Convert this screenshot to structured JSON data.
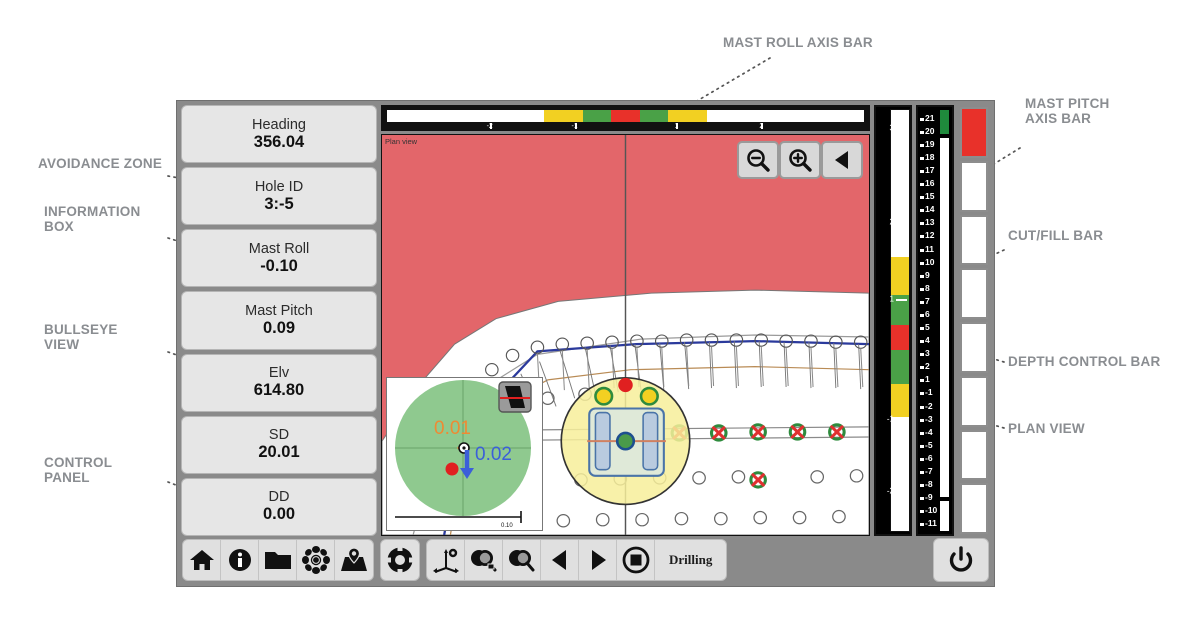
{
  "annotations": {
    "mast_roll_axis_bar": "MAST ROLL AXIS BAR",
    "avoidance_zone": "AVOIDANCE ZONE",
    "information_box": "INFORMATION\nBOX",
    "bullseye_view": "BULLSEYE\nVIEW",
    "control_panel": "CONTROL\nPANEL",
    "mast_pitch_axis_bar": "MAST PITCH\nAXIS BAR",
    "cut_fill_bar": "CUT/FILL BAR",
    "depth_control_bar": "DEPTH CONTROL BAR",
    "plan_view": "PLAN VIEW"
  },
  "info_panel": {
    "items": [
      {
        "label": "Heading",
        "value": "356.04"
      },
      {
        "label": "Hole ID",
        "value": "3:-5"
      },
      {
        "label": "Mast Roll",
        "value": "-0.10"
      },
      {
        "label": "Mast Pitch",
        "value": "0.09"
      },
      {
        "label": "Elv",
        "value": "614.80"
      },
      {
        "label": "SD",
        "value": "20.01"
      },
      {
        "label": "DD",
        "value": "0.00"
      }
    ]
  },
  "plan_view": {
    "label": "Plan view",
    "buttons": [
      {
        "name": "zoom-out-button",
        "icon": "magnifier-minus-icon"
      },
      {
        "name": "zoom-in-button",
        "icon": "magnifier-plus-icon"
      },
      {
        "name": "back-button",
        "icon": "triangle-left-icon"
      }
    ],
    "avoidance_zone_color": "#e3666a",
    "ground_color": "#ffffff",
    "design_line_color": "#2b3a9c",
    "rig_circle_color": "#f7ef9a"
  },
  "bullseye": {
    "offset_across": "0.01",
    "offset_along": "0.02",
    "across_color": "#ef8a33",
    "along_color": "#3b5fd9",
    "zone_color": "#8fc98f",
    "scale_label": "0.10"
  },
  "mast_roll_bar": {
    "ticks": [
      "-2",
      "-1",
      "1",
      "2"
    ],
    "segments": [
      {
        "color": "#ffffff",
        "pct": 33
      },
      {
        "color": "#f2d022",
        "pct": 8
      },
      {
        "color": "#4aa147",
        "pct": 6
      },
      {
        "color": "#e8312a",
        "pct": 6
      },
      {
        "color": "#4aa147",
        "pct": 6
      },
      {
        "color": "#f2d022",
        "pct": 8
      },
      {
        "color": "#ffffff",
        "pct": 33
      }
    ]
  },
  "mast_pitch_bar": {
    "ticks": [
      "3",
      "2",
      "1",
      "-1",
      "-2"
    ],
    "segments": [
      {
        "color": "#ffffff",
        "pct": 35
      },
      {
        "color": "#f2d022",
        "pct": 9
      },
      {
        "color": "#4aa147",
        "pct": 7
      },
      {
        "color": "#e8312a",
        "pct": 6
      },
      {
        "color": "#4aa147",
        "pct": 8
      },
      {
        "color": "#f2d022",
        "pct": 8
      },
      {
        "color": "#ffffff",
        "pct": 27
      }
    ]
  },
  "depth_control_bar": {
    "ticks": [
      "21",
      "20",
      "19",
      "18",
      "17",
      "16",
      "15",
      "14",
      "13",
      "12",
      "11",
      "10",
      "9",
      "8",
      "7",
      "6",
      "5",
      "4",
      "3",
      "2",
      "1",
      "-1",
      "-2",
      "-3",
      "-4",
      "-5",
      "-6",
      "-7",
      "-8",
      "-9",
      "-10",
      "-11"
    ],
    "top_indicator_color": "#1f8a3c"
  },
  "cut_fill_bar": {
    "segments": [
      {
        "filled": true
      },
      {
        "filled": false
      },
      {
        "filled": false
      },
      {
        "filled": false
      },
      {
        "filled": false
      },
      {
        "filled": false
      },
      {
        "filled": false
      },
      {
        "filled": false
      }
    ],
    "fill_color": "#e8312a"
  },
  "toolbar": {
    "group1": [
      {
        "name": "home-button",
        "icon": "home-icon"
      },
      {
        "name": "info-button",
        "icon": "info-icon"
      },
      {
        "name": "files-button",
        "icon": "folder-icon"
      },
      {
        "name": "gnss-button",
        "icon": "satellite-flower-icon"
      },
      {
        "name": "map-button",
        "icon": "map-pin-icon"
      }
    ],
    "group2": [
      {
        "name": "help-button",
        "icon": "life-ring-icon"
      }
    ],
    "group3": [
      {
        "name": "axes-setup-button",
        "icon": "axis-gear-icon"
      },
      {
        "name": "zoom-view-button",
        "icon": "magnifier-window-icon"
      },
      {
        "name": "zoom-area-button",
        "icon": "magnifier-icon"
      },
      {
        "name": "prev-button",
        "icon": "triangle-left-icon"
      },
      {
        "name": "next-button",
        "icon": "triangle-right-icon"
      },
      {
        "name": "stop-button",
        "icon": "stop-circle-icon"
      }
    ],
    "status_label": "Drilling",
    "power": {
      "name": "power-button",
      "icon": "power-icon"
    }
  }
}
